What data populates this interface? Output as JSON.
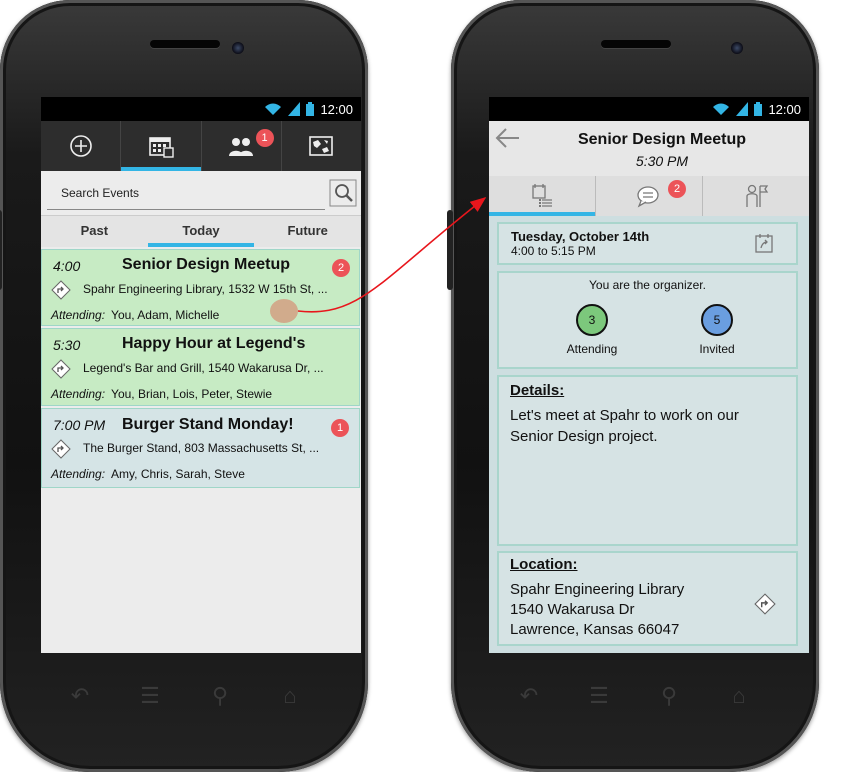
{
  "status": {
    "time": "12:00"
  },
  "left": {
    "topnav": [
      {
        "icon": "add-icon"
      },
      {
        "icon": "calendar-icon",
        "active": true
      },
      {
        "icon": "group-icon",
        "badge": "1"
      },
      {
        "icon": "map-icon"
      }
    ],
    "search": {
      "placeholder": "Search Events"
    },
    "subtabs": [
      "Past",
      "Today",
      "Future"
    ],
    "events": [
      {
        "time": "4:00",
        "title": "Senior Design Meetup",
        "badge": "2",
        "location": "Spahr Engineering Library, 1532 W 15th St, ...",
        "attending_label": "Attending:",
        "attendees": "You, Adam, Michelle",
        "color": "#c7ebc4"
      },
      {
        "time": "5:30",
        "title": "Happy Hour at Legend's",
        "badge": "",
        "location": "Legend's Bar and Grill, 1540 Wakarusa Dr, ...",
        "attending_label": "Attending:",
        "attendees": "You, Brian, Lois, Peter, Stewie",
        "color": "#c7ebc4"
      },
      {
        "time": "7:00 PM",
        "title": "Burger Stand Monday!",
        "badge": "1",
        "location": "The Burger Stand, 803 Massachusetts St, ...",
        "attending_label": "Attending:",
        "attendees": "Amy, Chris, Sarah, Steve",
        "color": "#d5e4e6"
      }
    ]
  },
  "right": {
    "title": "Senior Design Meetup",
    "time": "5:30 PM",
    "tabs": [
      {
        "icon": "event-details-icon",
        "active": true
      },
      {
        "icon": "chat-icon",
        "badge": "2"
      },
      {
        "icon": "people-flag-icon"
      }
    ],
    "date": "Tuesday, October 14th",
    "time_range": "4:00 to 5:15 PM",
    "organizer_text": "You are the organizer.",
    "attending": {
      "count": "3",
      "label": "Attending",
      "color": "#7cc87c"
    },
    "invited": {
      "count": "5",
      "label": "Invited",
      "color": "#6a9ee0"
    },
    "details": {
      "heading": "Details:",
      "text": "Let's meet at Spahr to work on our Senior Design project."
    },
    "location": {
      "heading": "Location:",
      "line1": "Spahr Engineering Library",
      "line2": "1540 Wakarusa Dr",
      "line3": "Lawrence, Kansas 66047"
    }
  },
  "colors": {
    "accent": "#33b5e5",
    "badge": "#ec5358",
    "connector": "#e8161c"
  }
}
